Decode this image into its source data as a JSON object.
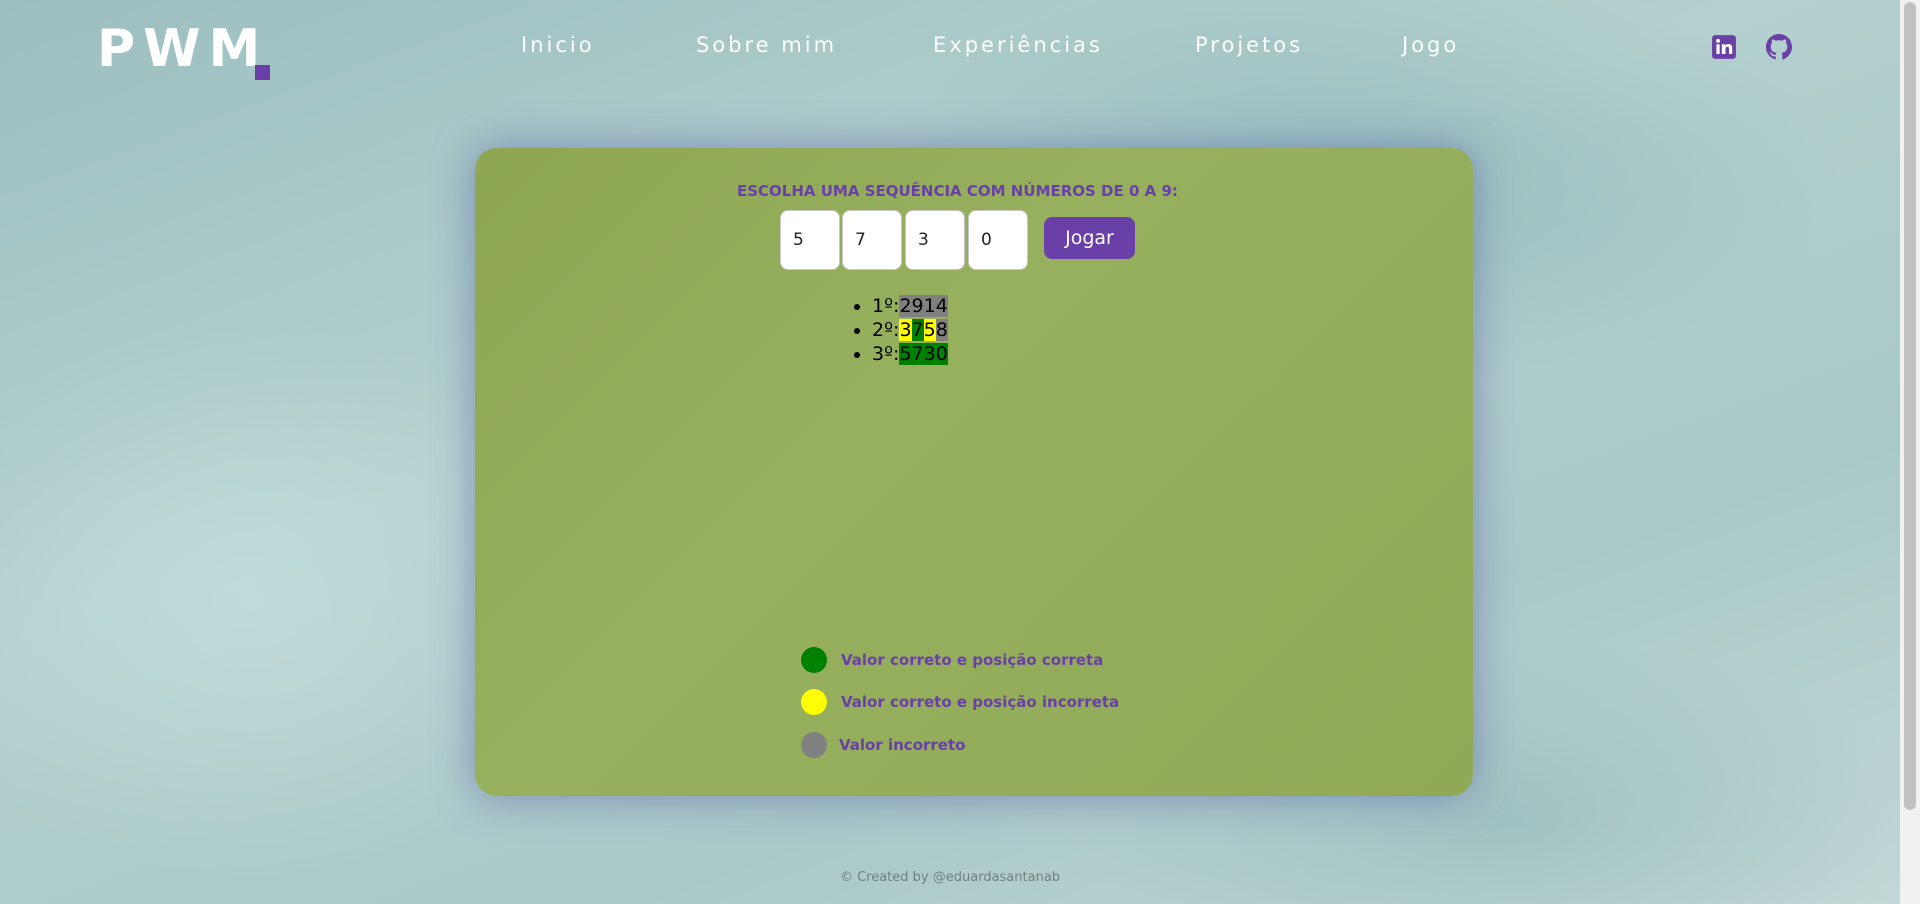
{
  "header": {
    "logo_text": "PWM",
    "nav": [
      "Inicio",
      "Sobre mim",
      "Experiências",
      "Projetos",
      "Jogo"
    ],
    "social_icons": [
      "linkedin-icon",
      "github-icon"
    ]
  },
  "game": {
    "prompt": "ESCOLHA UMA SEQUÊNCIA COM NÚMEROS DE 0 A 9:",
    "inputs": [
      "5",
      "7",
      "3",
      "0"
    ],
    "play_label": "Jogar",
    "attempts": [
      {
        "label": "1º:",
        "digits": [
          {
            "d": "2",
            "s": "gray"
          },
          {
            "d": "9",
            "s": "gray"
          },
          {
            "d": "1",
            "s": "gray"
          },
          {
            "d": "4",
            "s": "gray"
          }
        ]
      },
      {
        "label": "2º:",
        "digits": [
          {
            "d": "3",
            "s": "yellow"
          },
          {
            "d": "7",
            "s": "green"
          },
          {
            "d": "5",
            "s": "yellow"
          },
          {
            "d": "8",
            "s": "gray"
          }
        ]
      },
      {
        "label": "3º:",
        "digits": [
          {
            "d": "5",
            "s": "green"
          },
          {
            "d": "7",
            "s": "green"
          },
          {
            "d": "3",
            "s": "green"
          },
          {
            "d": "0",
            "s": "green"
          }
        ]
      }
    ],
    "legend": [
      {
        "color": "#008000",
        "label": "Valor correto e posição correta"
      },
      {
        "color": "#ffff00",
        "label": "Valor correto e posição incorreta"
      },
      {
        "color": "#808080",
        "label": "Valor incorreto"
      }
    ]
  },
  "footer": {
    "text": "© Created by @eduardasantanab"
  },
  "colors": {
    "accent": "#6a3fa8",
    "card": "#8fa955",
    "correct": "#008000",
    "misplaced": "#ffff00",
    "wrong": "#808080"
  }
}
